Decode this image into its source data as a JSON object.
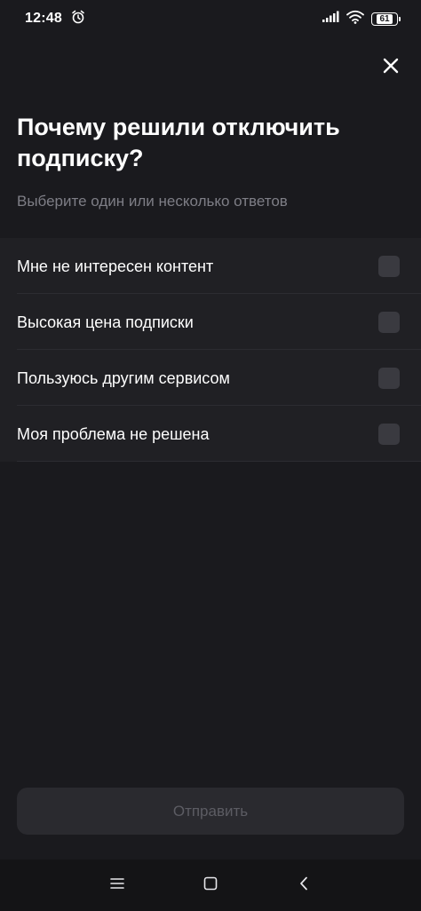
{
  "status_bar": {
    "time": "12:48",
    "battery": "61",
    "icons": [
      "alarm-icon",
      "signal-icon",
      "wifi-icon",
      "battery-icon"
    ]
  },
  "header": {
    "close_icon": "close-icon"
  },
  "main": {
    "title": "Почему решили отключить подписку?",
    "subtitle": "Выберите один или несколько ответов",
    "options": [
      {
        "label": "Мне не интересен контент",
        "checked": false
      },
      {
        "label": "Высокая цена подписки",
        "checked": false
      },
      {
        "label": "Пользуюсь другим сервисом",
        "checked": false
      },
      {
        "label": "Моя проблема не решена",
        "checked": false
      }
    ],
    "submit_label": "Отправить"
  },
  "nav_bar": {
    "icons": [
      "menu-icon",
      "home-icon",
      "back-icon"
    ]
  },
  "colors": {
    "background": "#1a1a1e",
    "options_background": "#202024",
    "checkbox": "#3a3a40",
    "button_disabled": "#2a2a2f",
    "text_secondary": "#7e7e86"
  }
}
